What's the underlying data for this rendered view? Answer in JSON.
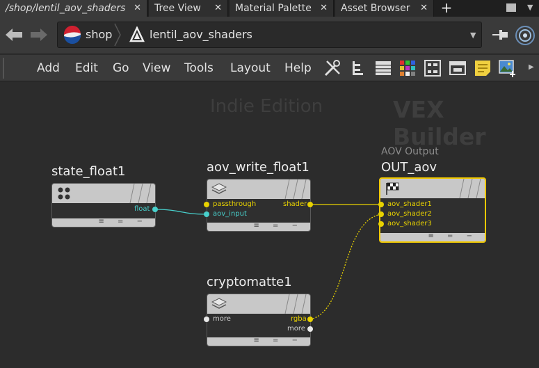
{
  "tabs": [
    {
      "label": "/shop/lentil_aov_shaders",
      "close": "✕"
    },
    {
      "label": "Tree View",
      "close": "✕"
    },
    {
      "label": "Material Palette",
      "close": "✕"
    },
    {
      "label": "Asset Browser",
      "close": "✕"
    }
  ],
  "tab_add": "+",
  "path": {
    "root": "shop",
    "current": "lentil_aov_shaders",
    "dropdown": "▼"
  },
  "menu": [
    "Add",
    "Edit",
    "Go",
    "View",
    "Tools",
    "Layout",
    "Help"
  ],
  "menu_more": "▶",
  "watermarks": {
    "edition": "Indie Edition",
    "context": "VEX Builder"
  },
  "nodes": {
    "state_float1": {
      "name": "state_float1",
      "outputs": [
        "float"
      ]
    },
    "aov_write_float1": {
      "name": "aov_write_float1",
      "inputs": [
        "passthrough",
        "aov_input"
      ],
      "outputs": [
        "shader"
      ]
    },
    "out_aov": {
      "label": "AOV Output",
      "name": "OUT_aov",
      "inputs": [
        "aov_shader1",
        "aov_shader2",
        "aov_shader3"
      ]
    },
    "cryptomatte1": {
      "name": "cryptomatte1",
      "inputs": [
        "more"
      ],
      "outputs": [
        "rgba",
        "more"
      ]
    }
  },
  "foot_glyphs": "≡ = −",
  "colors": {
    "float_wire": "#48d0cc",
    "shader_wire": "#e8d200",
    "selected": "#f0c800"
  }
}
